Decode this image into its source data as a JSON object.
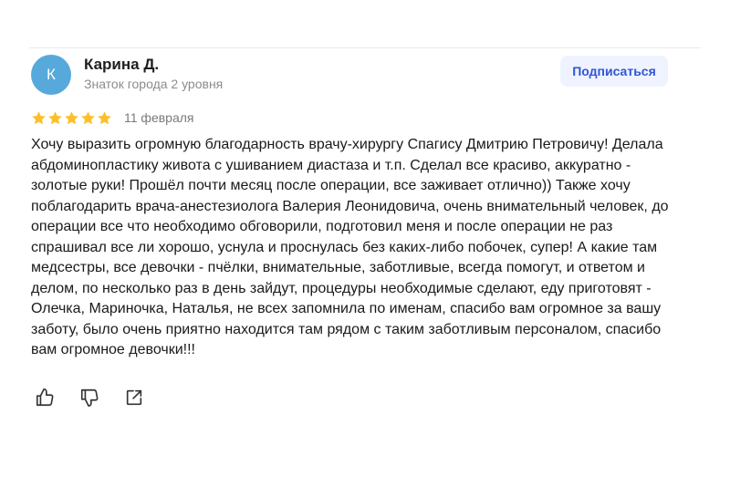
{
  "review": {
    "author": {
      "initial": "К",
      "name": "Карина Д.",
      "level": "Знаток города 2 уровня"
    },
    "subscribe_label": "Подписаться",
    "rating": 5,
    "rating_max": 5,
    "date": "11 февраля",
    "text": "Хочу выразить огромную благодарность врачу-хирургу Спагису Дмитрию Петровичу! Делала абдоминопластику живота с ушиванием диастаза и т.п. Сделал все красиво, аккуратно - золотые руки! Прошёл почти месяц после операции, все заживает отлично)) Также хочу поблагодарить врача-анестезиолога Валерия Леонидовича, очень внимательный человек, до операции все что необходимо обговорили, подготовил меня и после операции не раз спрашивал все ли хорошо, уснула и проснулась без каких-либо побочек, супер! А какие там медсестры, все девочки - пчёлки, внимательные, заботливые, всегда помогут, и ответом и делом, по несколько раз в день зайдут, процедуры необходимые сделают, еду приготовят - Олечка, Мариночка, Наталья, не всех запомнила по именам, спасибо вам огромное за вашу заботу, было очень приятно находится там рядом с таким заботливым персоналом, спасибо вам огромное девочки!!!"
  },
  "actions": {
    "like_icon": "thumbs-up-icon",
    "dislike_icon": "thumbs-down-icon",
    "share_icon": "share-icon"
  },
  "colors": {
    "avatar": "#57a9dc",
    "star": "#fcbf2c",
    "subscribe_bg": "#eef3ff",
    "subscribe_text": "#3155d6"
  }
}
